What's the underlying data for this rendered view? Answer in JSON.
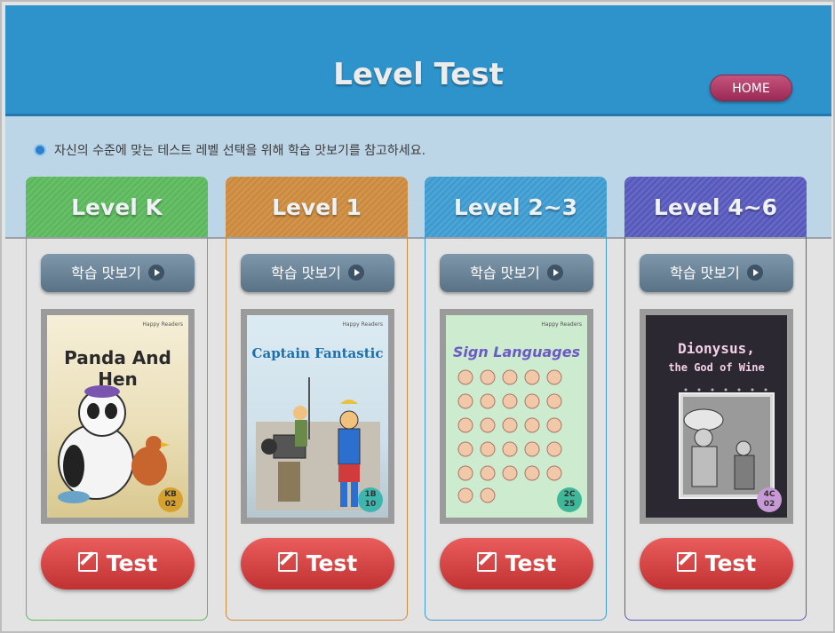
{
  "header": {
    "title": "Level Test",
    "home_label": "HOME"
  },
  "notice": "자신의 수준에  맞는 테스트 레벨 선택을 위해 학습 맛보기를 참고하세요.",
  "cards": [
    {
      "level": "Level K",
      "preview_label": "학습 맛보기",
      "test_label": "Test",
      "book": {
        "publisher": "Happy Readers",
        "title": "Panda And Hen",
        "code": "KB 02"
      }
    },
    {
      "level": "Level 1",
      "preview_label": "학습 맛보기",
      "test_label": "Test",
      "book": {
        "publisher": "Happy Readers",
        "title": "Captain Fantastic",
        "code": "1B 10"
      }
    },
    {
      "level": "Level 2~3",
      "preview_label": "학습 맛보기",
      "test_label": "Test",
      "book": {
        "publisher": "Happy Readers",
        "title": "Sign Languages",
        "code": "2C 25"
      }
    },
    {
      "level": "Level 4~6",
      "preview_label": "학습 맛보기",
      "test_label": "Test",
      "book": {
        "publisher": "",
        "title_line1": "Dionysus,",
        "title_line2": "the God of Wine",
        "code": "4C 02"
      }
    }
  ],
  "colors": {
    "header_bg": "#2f93cb",
    "band_bg": "#bcd5e7",
    "level_k": "#5bb85b",
    "level_1": "#cc8a3d",
    "level_2_3": "#3e9bd0",
    "level_4_6": "#5859bd",
    "test_button": "#d94444",
    "home_button": "#b13e68"
  }
}
